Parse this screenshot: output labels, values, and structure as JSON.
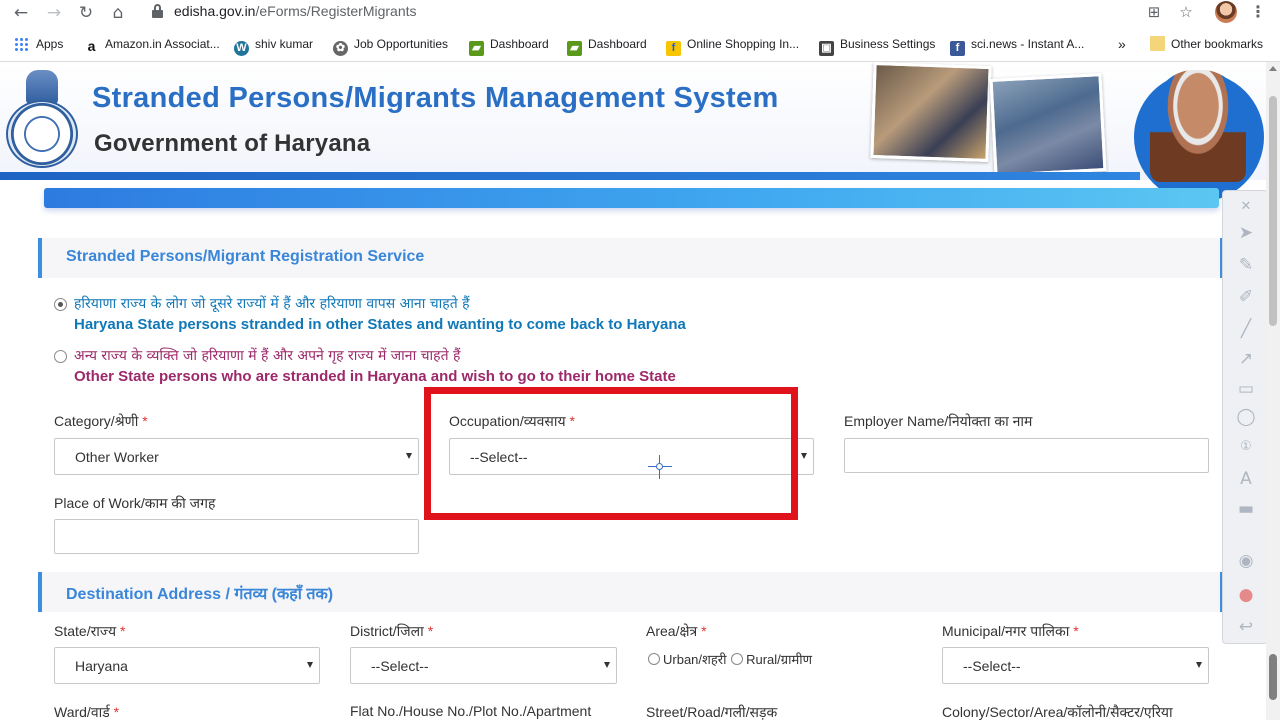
{
  "browser": {
    "url_host": "edisha.gov.in",
    "url_path": "/eForms/RegisterMigrants",
    "bookmarks": [
      {
        "label": "Apps"
      },
      {
        "label": "Amazon.in Associat..."
      },
      {
        "label": "shiv kumar"
      },
      {
        "label": "Job Opportunities"
      },
      {
        "label": "Dashboard"
      },
      {
        "label": "Dashboard"
      },
      {
        "label": "Online Shopping In..."
      },
      {
        "label": "Business Settings"
      },
      {
        "label": "sci.news - Instant A..."
      },
      {
        "label": "»"
      },
      {
        "label": "Other bookmarks"
      }
    ]
  },
  "header": {
    "title": "Stranded Persons/Migrants Management System",
    "subtitle": "Government of Haryana"
  },
  "registration": {
    "section_title": "Stranded Persons/Migrant Registration Service",
    "option1_hi": "हरियाणा राज्य के लोग जो दूसरे राज्यों में हैं और हरियाणा वापस आना चाहते हैं",
    "option1_en": "Haryana State persons stranded in other States and wanting to come back to Haryana",
    "option2_hi": "अन्य राज्य के व्यक्ति जो हरियाणा में हैं और अपने गृह राज्य में जाना चाहते हैं",
    "option2_en": "Other State persons who are stranded in Haryana and wish to go to their home State",
    "category_label": "Category/श्रेणी",
    "category_value": "Other Worker",
    "occupation_label": "Occupation/व्यवसाय",
    "occupation_value": "--Select--",
    "employer_label": "Employer Name/नियोक्ता का नाम",
    "employer_value": "",
    "place_label": "Place of Work/काम की जगह",
    "place_value": "",
    "required_mark": "*"
  },
  "destination": {
    "section_title": "Destination Address / गंतव्य (कहाँ तक)",
    "state_label": "State/राज्य",
    "state_value": "Haryana",
    "district_label": "District/जिला",
    "district_value": "--Select--",
    "area_label": "Area/क्षेत्र",
    "area_urban": "Urban/शहरी",
    "area_rural": "Rural/ग्रामीण",
    "municipal_label": "Municipal/नगर पालिका",
    "municipal_value": "--Select--",
    "ward_label": "Ward/वार्ड",
    "flat_label": "Flat No./House No./Plot No./Apartment",
    "street_label": "Street/Road/गली/सड़क",
    "colony_label": "Colony/Sector/Area/कॉलोनी/सैक्टर/एरिया"
  },
  "colors": {
    "accent_blue": "#3a86d8",
    "highlight_red": "#e0121b",
    "purple_text": "#9c2a6a"
  }
}
